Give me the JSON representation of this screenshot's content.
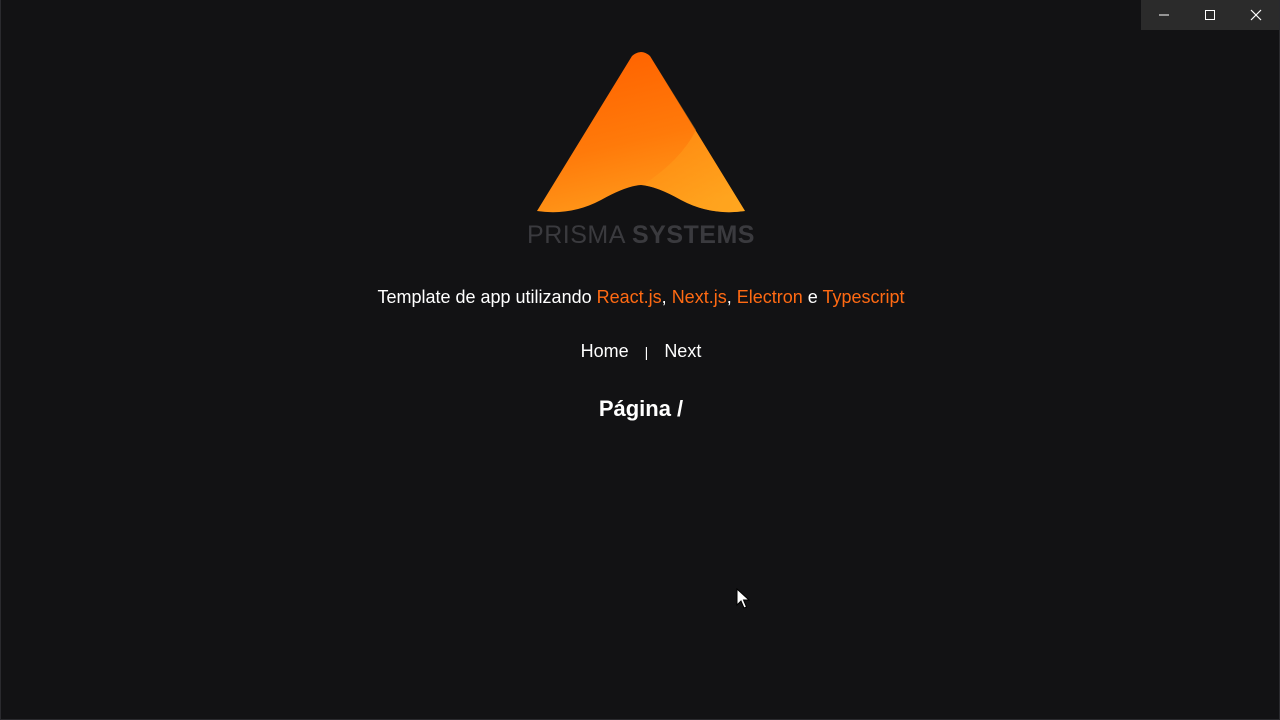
{
  "window_controls": {
    "minimize_icon": "minimize-icon",
    "maximize_icon": "maximize-icon",
    "close_icon": "close-icon"
  },
  "logo": {
    "icon": "prisma-triangle-logo",
    "brand_light": "PRISMA",
    "brand_bold": "SYSTEMS",
    "colors": {
      "top": "#ff6a00",
      "bottom": "#ffa31a",
      "brand_text": "#3a3a3e"
    }
  },
  "subtitle": {
    "prefix": "Template de app utilizando",
    "tech1": "React.js",
    "sep1": ",",
    "tech2": "Next.js",
    "sep2": ",",
    "tech3": "Electron",
    "conj": "e",
    "tech4": "Typescript",
    "accent_color": "#ff6a13"
  },
  "nav": {
    "home": "Home",
    "separator": "|",
    "next": "Next"
  },
  "page_heading": "Página /"
}
